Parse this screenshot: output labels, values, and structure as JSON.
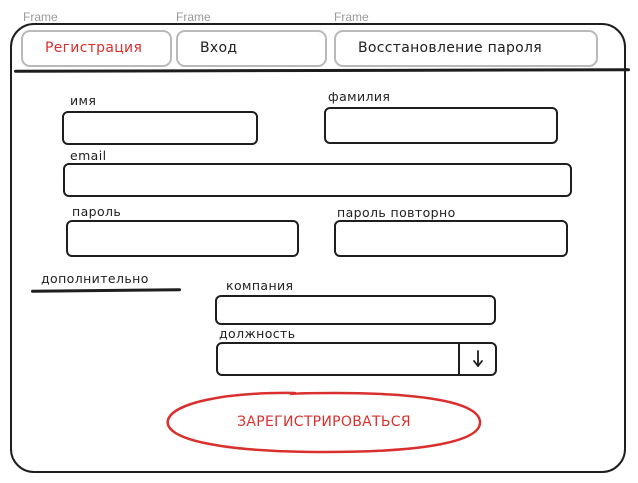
{
  "frame_labels": [
    "Frame",
    "Frame",
    "Frame"
  ],
  "tabs": [
    {
      "label": "Регистрация",
      "active": true
    },
    {
      "label": "Вход",
      "active": false
    },
    {
      "label": "Восстановление пароля",
      "active": false
    }
  ],
  "form": {
    "first_name_label": "имя",
    "last_name_label": "фамилия",
    "email_label": "email",
    "password_label": "пароль",
    "password_repeat_label": "пароль повторно",
    "section_additional": "дополнительно",
    "company_label": "компания",
    "position_label": "должность",
    "submit_label": "ЗАРЕГИСТРИРОВАТЬСЯ"
  },
  "icons": {
    "select_arrow": "arrow-down-icon"
  },
  "colors": {
    "accent": "#d9302e",
    "ink": "#1e1e1e",
    "tab_border": "#b9b9b9",
    "frame_label": "#9a9a9a"
  }
}
